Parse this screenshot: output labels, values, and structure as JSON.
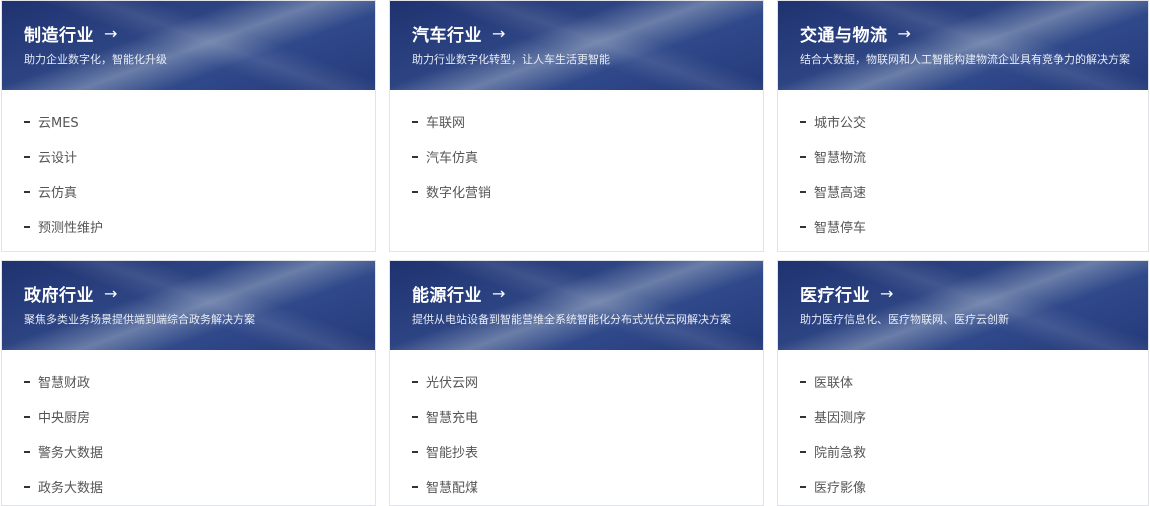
{
  "cards": [
    {
      "title": "制造行业",
      "arrow": "→",
      "desc": "助力企业数字化，智能化升级",
      "items": [
        "云MES",
        "云设计",
        "云仿真",
        "预测性维护"
      ]
    },
    {
      "title": "汽车行业",
      "arrow": "→",
      "desc": "助力行业数字化转型，让人车生活更智能",
      "items": [
        "车联网",
        "汽车仿真",
        "数字化营销"
      ]
    },
    {
      "title": "交通与物流",
      "arrow": "→",
      "desc": "结合大数据，物联网和人工智能构建物流企业具有竞争力的解决方案",
      "items": [
        "城市公交",
        "智慧物流",
        "智慧高速",
        "智慧停车"
      ]
    },
    {
      "title": "政府行业",
      "arrow": "→",
      "desc": "聚焦多类业务场景提供端到端综合政务解决方案",
      "items": [
        "智慧财政",
        "中央厨房",
        "警务大数据",
        "政务大数据"
      ]
    },
    {
      "title": "能源行业",
      "arrow": "→",
      "desc": "提供从电站设备到智能营维全系统智能化分布式光伏云网解决方案",
      "items": [
        "光伏云网",
        "智慧充电",
        "智能抄表",
        "智慧配煤"
      ]
    },
    {
      "title": "医疗行业",
      "arrow": "→",
      "desc": "助力医疗信息化、医疗物联网、医疗云创新",
      "items": [
        "医联体",
        "基因测序",
        "院前急救",
        "医疗影像"
      ]
    }
  ]
}
